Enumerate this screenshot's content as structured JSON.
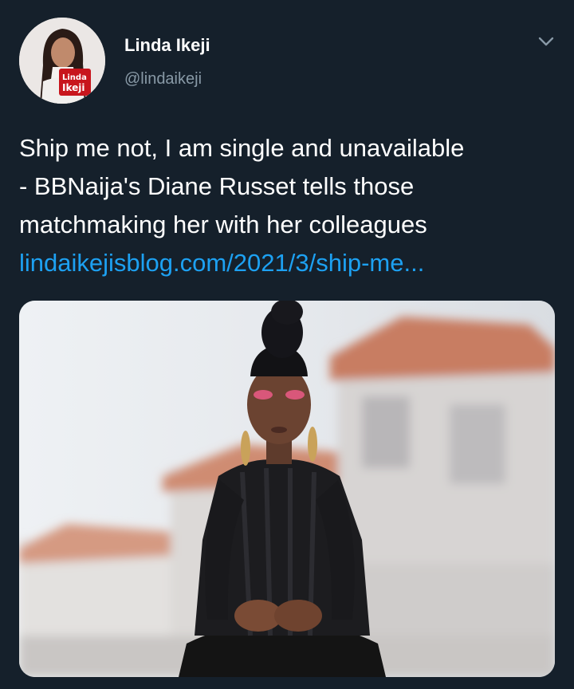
{
  "tweet": {
    "author_name": "Linda Ikeji",
    "author_handle": "@lindaikeji",
    "avatar_badge_line1": "Linda",
    "avatar_badge_line2": "Ikeji",
    "text_lines": [
      "Ship me not, I am single and unavailable",
      "- BBNaija's Diane Russet tells those",
      "matchmaking her with her colleagues"
    ],
    "link_text": "lindaikejisblog.com/2021/3/ship-me..."
  },
  "icons": {
    "menu": "chevron-down-icon"
  },
  "colors": {
    "background": "#15202b",
    "link": "#1da1f2",
    "secondary_text": "#8899a6"
  }
}
